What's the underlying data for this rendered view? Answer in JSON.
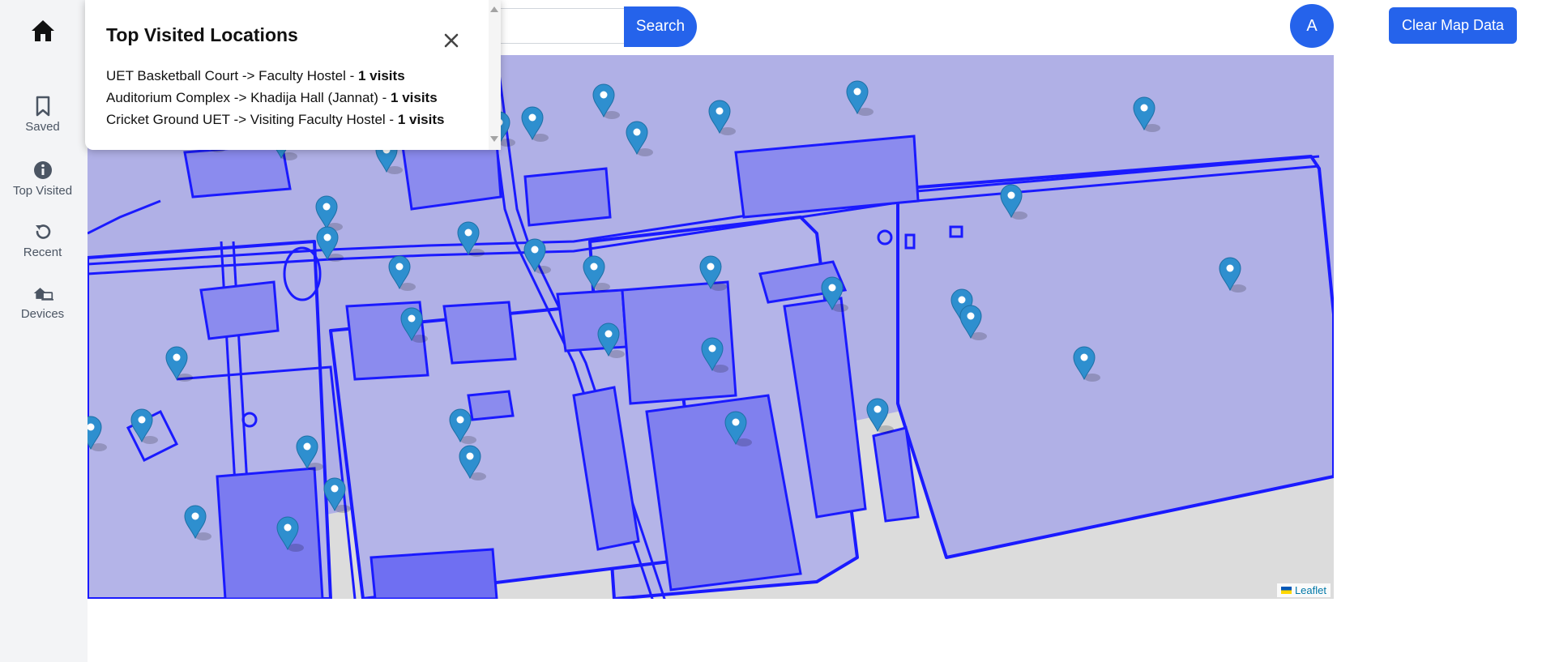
{
  "sidebar": {
    "home_icon": "home-icon",
    "items": [
      {
        "label": "Saved",
        "icon": "bookmark-icon"
      },
      {
        "label": "Top Visited",
        "icon": "info-icon"
      },
      {
        "label": "Recent",
        "icon": "history-icon"
      },
      {
        "label": "Devices",
        "icon": "devices-icon"
      }
    ]
  },
  "search": {
    "value": "",
    "button_label": "Search"
  },
  "user": {
    "avatar_initial": "A"
  },
  "header": {
    "clear_button_label": "Clear Map Data"
  },
  "popup": {
    "title": "Top Visited Locations",
    "close_icon": "close-icon",
    "rows": [
      {
        "route": "UET Basketball Court -> Faculty Hostel - ",
        "visits": "1 visits"
      },
      {
        "route": "Auditorium Complex -> Khadija Hall (Jannat) - ",
        "visits": "1 visits"
      },
      {
        "route": "Cricket Ground UET -> Visiting Faculty Hostel - ",
        "visits": "1 visits"
      }
    ]
  },
  "map": {
    "attribution": "Leaflet",
    "marker_icon": "map-marker-icon",
    "colors": {
      "outline": "#1a1aff",
      "fill": "#b0b0e6",
      "building": "#8b8bee",
      "marker": "#2e8fcf",
      "accent": "#2563eb"
    }
  }
}
